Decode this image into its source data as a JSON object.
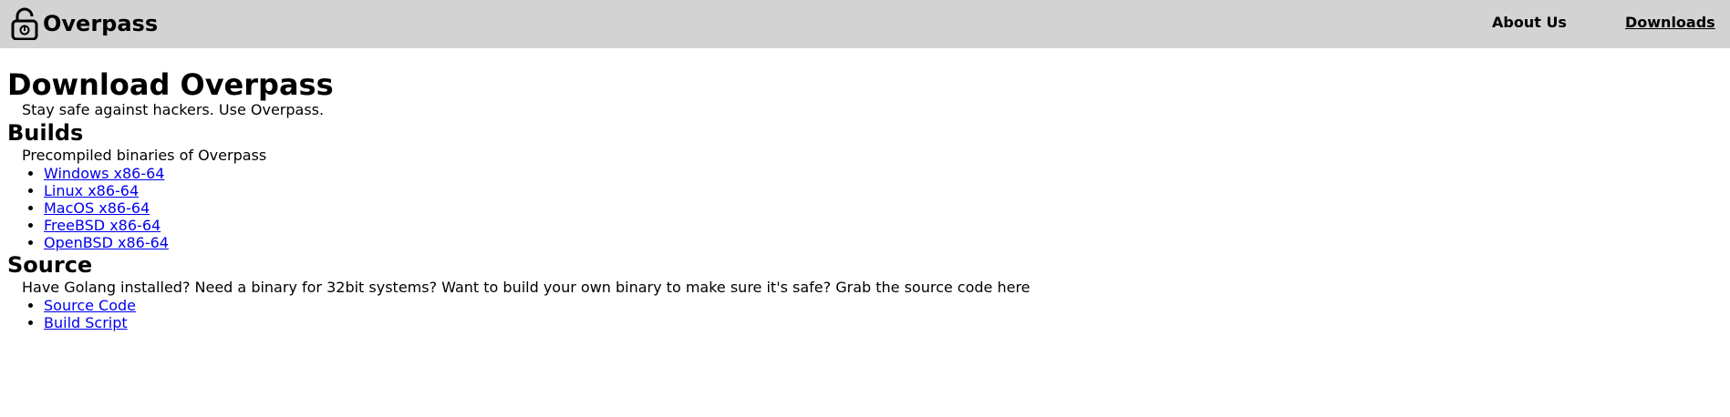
{
  "header": {
    "brand_name": "Overpass",
    "brand_icon": "padlock-icon",
    "nav": {
      "about_label": "About Us",
      "downloads_label": "Downloads"
    }
  },
  "main": {
    "title": "Download Overpass",
    "tagline": "Stay safe against hackers. Use Overpass.",
    "builds": {
      "heading": "Builds",
      "description": "Precompiled binaries of Overpass",
      "links": [
        "Windows x86-64",
        "Linux x86-64",
        "MacOS x86-64",
        "FreeBSD x86-64",
        "OpenBSD x86-64"
      ]
    },
    "source": {
      "heading": "Source",
      "description": "Have Golang installed? Need a binary for 32bit systems? Want to build your own binary to make sure it's safe? Grab the source code here",
      "links": [
        "Source Code",
        "Build Script"
      ]
    }
  },
  "colors": {
    "header_bg": "#d3d3d3",
    "link": "#0000ee",
    "text": "#000000"
  }
}
